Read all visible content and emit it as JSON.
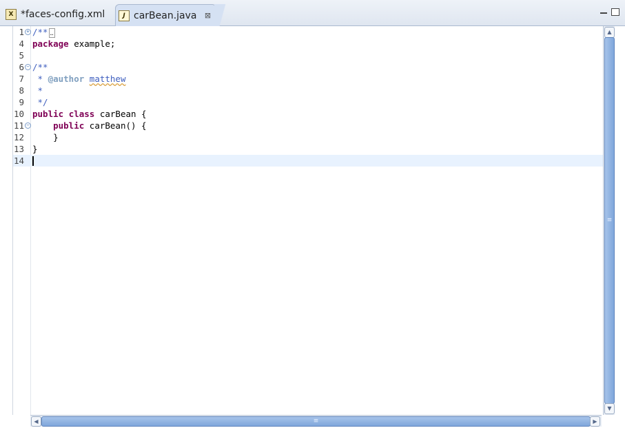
{
  "tabs": [
    {
      "label": "*faces-config.xml",
      "icon": "xml-file-icon",
      "active": false
    },
    {
      "label": "carBean.java",
      "icon": "java-file-icon",
      "active": true,
      "close": "⊠"
    }
  ],
  "editor": {
    "lines": [
      {
        "num": "1",
        "fold": "expand",
        "tokens": [
          {
            "t": "/**",
            "c": "cm"
          }
        ],
        "folded_marker": "…"
      },
      {
        "num": "4",
        "tokens": [
          {
            "t": "package",
            "c": "kw"
          },
          {
            "t": " example;",
            "c": "plain"
          }
        ]
      },
      {
        "num": "5",
        "tokens": []
      },
      {
        "num": "6",
        "fold": "collapse",
        "tokens": [
          {
            "t": "/**",
            "c": "cm"
          }
        ]
      },
      {
        "num": "7",
        "tokens": [
          {
            "t": " * ",
            "c": "cm"
          },
          {
            "t": "@author",
            "c": "tag"
          },
          {
            "t": " ",
            "c": "cm"
          },
          {
            "t": "matthew",
            "c": "tag-arg"
          }
        ]
      },
      {
        "num": "8",
        "tokens": [
          {
            "t": " *",
            "c": "cm"
          }
        ]
      },
      {
        "num": "9",
        "tokens": [
          {
            "t": " */",
            "c": "cm"
          }
        ]
      },
      {
        "num": "10",
        "tokens": [
          {
            "t": "public",
            "c": "kw"
          },
          {
            "t": " ",
            "c": "plain"
          },
          {
            "t": "class",
            "c": "kw"
          },
          {
            "t": " carBean {",
            "c": "plain"
          }
        ]
      },
      {
        "num": "11",
        "fold": "collapse",
        "tokens": [
          {
            "t": "    ",
            "c": "plain"
          },
          {
            "t": "public",
            "c": "kw"
          },
          {
            "t": " carBean() {",
            "c": "plain"
          }
        ]
      },
      {
        "num": "12",
        "tokens": [
          {
            "t": "    }",
            "c": "plain"
          }
        ]
      },
      {
        "num": "13",
        "tokens": [
          {
            "t": "}",
            "c": "plain"
          }
        ]
      },
      {
        "num": "14",
        "tokens": [],
        "current": true
      }
    ],
    "colors": {
      "keyword": "#7f0055",
      "comment": "#3f5fbf",
      "javadoc_tag": "#7f9fbf",
      "current_line": "#e8f2fe"
    }
  },
  "scrollbars": {
    "grip": "≡"
  }
}
